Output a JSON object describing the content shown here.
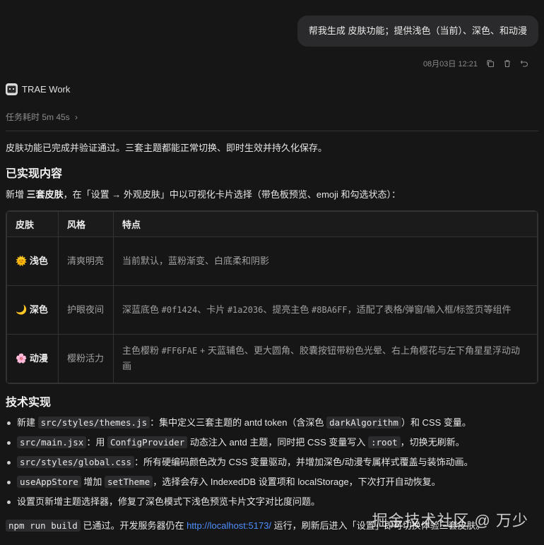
{
  "user_message": {
    "text": "帮我生成 皮肤功能；提供浅色（当前）、深色、和动漫",
    "timestamp": "08月03日 12:21",
    "actions": [
      "copy-icon",
      "trash-icon",
      "undo-icon"
    ]
  },
  "agent": {
    "name": "TRAE Work",
    "task_time": "任务耗时 5m 45s",
    "task_time_chevron": "›"
  },
  "response": {
    "intro": "皮肤功能已完成并验证通过。三套主题都能正常切换、即时生效并持久化保存。",
    "section1_title": "已实现内容",
    "section1_text_a": "新增 ",
    "section1_text_b": "三套皮肤",
    "section1_text_c": "，在「设置 → 外观皮肤」中以可视化卡片选择（带色板预览、emoji 和勾选状态）：",
    "table": {
      "headers": [
        "皮肤",
        "风格",
        "特点"
      ],
      "rows": [
        {
          "emoji": "🌞",
          "skin": "浅色",
          "style": "清爽明亮",
          "feature": "当前默认，蓝粉渐变、白底柔和阴影"
        },
        {
          "emoji": "🌙",
          "skin": "深色",
          "style": "护眼夜间",
          "feature_a": "深蓝底色 ",
          "code1": "#0f1424",
          "feature_b": "、卡片 ",
          "code2": "#1a2036",
          "feature_c": "、提亮主色 ",
          "code3": "#8BA6FF",
          "feature_d": "，适配了表格/弹窗/输入框/标签页等组件"
        },
        {
          "emoji": "🌸",
          "skin": "动漫",
          "style": "樱粉活力",
          "feature_a": "主色樱粉 ",
          "code1": "#FF6FAE",
          "feature_b": " + 天蓝辅色、更大圆角、胶囊按钮带粉色光晕、右上角樱花与左下角星星浮动动画"
        }
      ]
    },
    "section2_title": "技术实现",
    "bullets": [
      {
        "code": "src/styles/themes.js",
        "pre": "新建 ",
        "text_a": "：集中定义三套主题的 antd token（含深色 ",
        "code2": "darkAlgorithm",
        "text_b": "）和 CSS 变量。"
      },
      {
        "code": "src/main.jsx",
        "text_a": "：用 ",
        "code2": "ConfigProvider",
        "text_b": " 动态注入 antd 主题，同时把 CSS 变量写入 ",
        "code3": ":root",
        "text_c": "，切换无刷新。"
      },
      {
        "code": "src/styles/global.css",
        "text_a": "：所有硬编码颜色改为 CSS 变量驱动，并增加深色/动漫专属样式覆盖与装饰动画。"
      },
      {
        "code": "useAppStore",
        "text_a": " 增加 ",
        "code2": "setTheme",
        "text_b": "，选择会存入 IndexedDB 设置项和 localStorage，下次打开自动恢复。"
      },
      {
        "text_a": "设置页新增主题选择器，修复了深色模式下浅色预览卡片文字对比度问题。"
      }
    ],
    "footer_code": "npm run build",
    "footer_a": " 已通过。开发服务器仍在 ",
    "footer_link": "http://localhost:5173/",
    "footer_b": " 运行，刷新后进入「设置」即可切换体验三套皮肤。"
  },
  "watermark": "掘金技术社区 @ 万少"
}
